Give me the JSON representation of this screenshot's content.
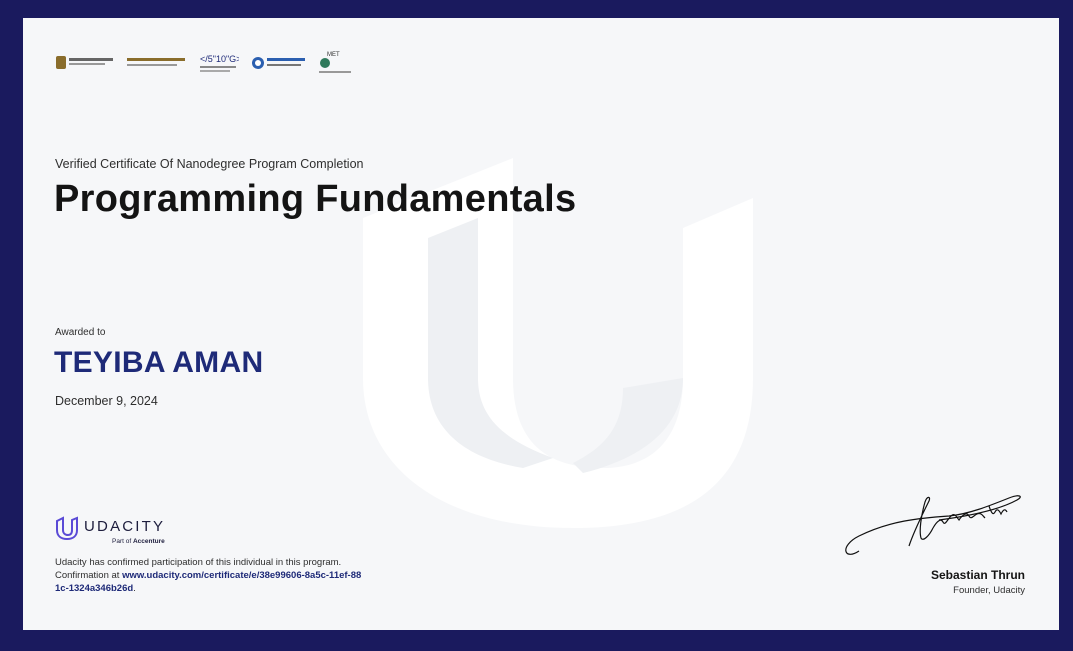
{
  "certificate": {
    "eyebrow": "Verified Certificate Of Nanodegree Program Completion",
    "program_title": "Programming Fundamentals",
    "awarded_label": "Awarded to",
    "recipient_name": "TEYIBA AMAN",
    "date": "December 9, 2024"
  },
  "partner_logos": [
    {
      "icon": "uae-emblem-icon"
    },
    {
      "icon": "government-entity-logo"
    },
    {
      "icon": "code-initiative-logo"
    },
    {
      "icon": "ministry-of-labor-logo"
    },
    {
      "icon": "met-logo"
    }
  ],
  "brand": {
    "name": "UDACITY",
    "sub_prefix": "Part of ",
    "sub_company": "Accenture",
    "accent_color": "#5a4ad6"
  },
  "confirmation": {
    "text": "Udacity has confirmed participation of this individual in this program. Confirmation at ",
    "link": "www.udacity.com/certificate/e/38e99606-8a5c-11ef-881c-1324a346b26d",
    "suffix": "."
  },
  "signatory": {
    "name": "Sebastian Thrun",
    "title": "Founder, Udacity"
  },
  "colors": {
    "frame": "#1a1a5e",
    "paper": "#f6f7f9",
    "recipient": "#1e2a78"
  }
}
